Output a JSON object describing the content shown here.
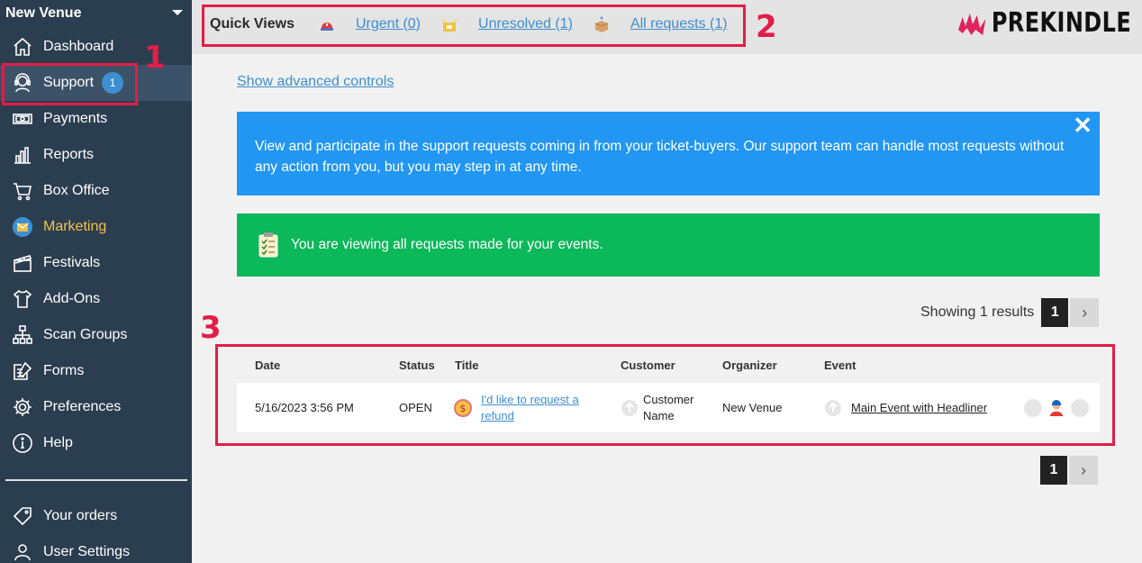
{
  "sidebar": {
    "venue": "New Venue",
    "items": [
      {
        "label": "Dashboard",
        "icon": "home-icon"
      },
      {
        "label": "Support",
        "icon": "headset-icon",
        "badge": "1"
      },
      {
        "label": "Payments",
        "icon": "money-icon"
      },
      {
        "label": "Reports",
        "icon": "bar-chart-icon"
      },
      {
        "label": "Box Office",
        "icon": "cart-icon"
      },
      {
        "label": "Marketing",
        "icon": "mail-icon"
      },
      {
        "label": "Festivals",
        "icon": "clapperboard-icon"
      },
      {
        "label": "Add-Ons",
        "icon": "tshirt-icon"
      },
      {
        "label": "Scan Groups",
        "icon": "org-chart-icon"
      },
      {
        "label": "Forms",
        "icon": "form-edit-icon"
      },
      {
        "label": "Preferences",
        "icon": "gear-icon"
      },
      {
        "label": "Help",
        "icon": "info-icon"
      }
    ],
    "bottom": [
      {
        "label": "Your orders",
        "icon": "tag-icon"
      },
      {
        "label": "User Settings",
        "icon": "user-icon"
      }
    ]
  },
  "quick_views": {
    "title": "Quick Views",
    "links": [
      {
        "label": "Urgent (0)",
        "icon": "alarm-icon"
      },
      {
        "label": "Unresolved (1)",
        "icon": "open-box-icon"
      },
      {
        "label": "All requests (1)",
        "icon": "package-icon"
      }
    ]
  },
  "logo": "PREKINDLE",
  "annotations": {
    "one": "1",
    "two": "2",
    "three": "3"
  },
  "main": {
    "advanced_link": "Show advanced controls",
    "info_text": "View and participate in the support requests coming in from your ticket-buyers. Our support team can handle most requests without any action from you, but you may step in at any time.",
    "close": "✕",
    "success_text": "You are viewing all requests made for your events.",
    "showing": "Showing 1 results",
    "page": "1",
    "next": "›"
  },
  "table": {
    "headers": {
      "date": "Date",
      "status": "Status",
      "title": "Title",
      "customer": "Customer",
      "organizer": "Organizer",
      "event": "Event"
    },
    "rows": [
      {
        "date": "5/16/2023 3:56 PM",
        "status": "OPEN",
        "title_line1": "I'd like to request a",
        "title_line2": "refund",
        "customer_line1": "Customer",
        "customer_line2": "Name",
        "organizer": "New Venue",
        "event": "Main Event with Headliner"
      }
    ]
  },
  "colors": {
    "sidebar": "#2b3e50",
    "accent": "#3d8fd1",
    "info": "#2196f3",
    "success": "#0bb85a",
    "annotation": "#e21d48",
    "marketing": "#f5c144"
  }
}
